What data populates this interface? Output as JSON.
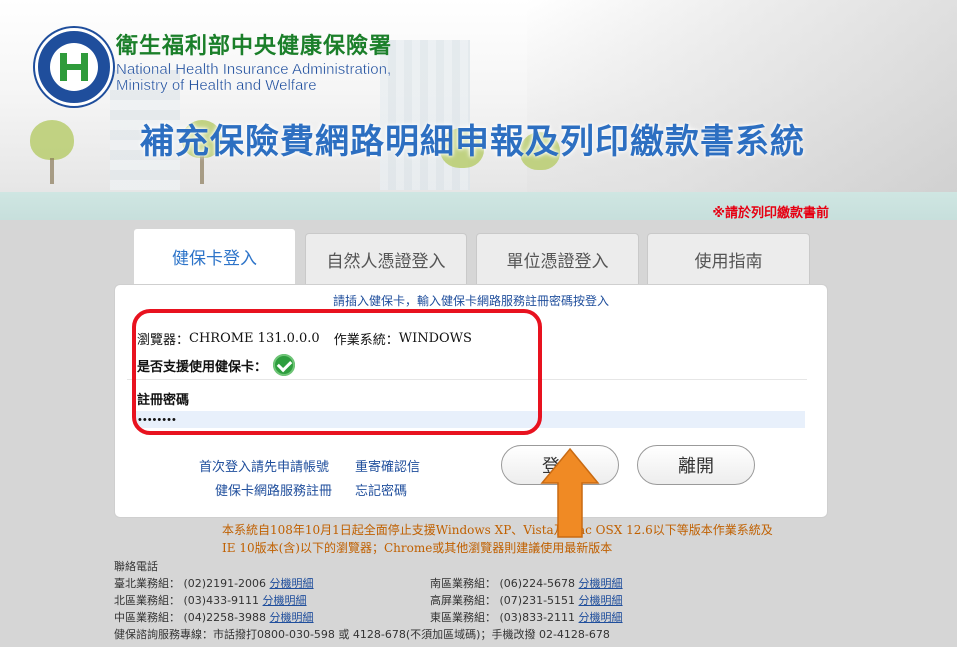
{
  "header": {
    "org_name_zh": "衛生福利部中央健康保險署",
    "org_name_en_line1": "National Health Insurance Administration,",
    "org_name_en_line2": "Ministry of Health and Welfare",
    "system_title": "補充保險費網路明細申報及列印繳款書系統",
    "top_notice": "※請於列印繳款書前"
  },
  "tabs": [
    {
      "label": "健保卡登入",
      "active": true
    },
    {
      "label": "自然人憑證登入",
      "active": false
    },
    {
      "label": "單位憑證登入",
      "active": false
    },
    {
      "label": "使用指南",
      "active": false
    }
  ],
  "panel": {
    "instruction": "請插入健保卡，輸入健保卡網路服務註冊密碼按登入",
    "browser_label": "瀏覽器：",
    "browser_value": "CHROME 131.0.0.0",
    "os_label": "作業系統：",
    "os_value": "WINDOWS",
    "support_label": "是否支援使用健保卡：",
    "support_icon": "check-circle-icon",
    "password_label": "註冊密碼",
    "password_value": "••••••••",
    "links": {
      "apply_account": "首次登入請先申請帳號",
      "resend_confirm": "重寄確認信",
      "register_service": "健保卡網路服務註冊",
      "forgot_password": "忘記密碼"
    },
    "login_button": "登入",
    "exit_button": "離開"
  },
  "warning_lines": [
    "本系統自108年10月1日起全面停止支援Windows XP、Vista及Mac OSX 12.6以下等版本作業系統及",
    "IE 10版本(含)以下的瀏覽器；Chrome或其他瀏覽器則建議使用最新版本"
  ],
  "contact": {
    "title": "聯絡電話",
    "rows": [
      {
        "left_label": "臺北業務組：",
        "left_phone": "(02)2191-2006",
        "left_link": "分機明細",
        "right_label": "南區業務組：",
        "right_phone": "(06)224-5678",
        "right_link": "分機明細"
      },
      {
        "left_label": "北區業務組：",
        "left_phone": "(03)433-9111",
        "left_link": "分機明細",
        "right_label": "高屏業務組：",
        "right_phone": "(07)231-5151",
        "right_link": "分機明細"
      },
      {
        "left_label": "中區業務組：",
        "left_phone": "(04)2258-3988",
        "left_link": "分機明細",
        "right_label": "東區業務組：",
        "right_phone": "(03)833-2111",
        "right_link": "分機明細"
      }
    ],
    "hotline": "健保諮詢服務專線：市話撥打0800-030-598 或 4128-678(不須加區域碼)；手機改撥 02-4128-678"
  },
  "colors": {
    "highlight_frame": "#e8121f",
    "arrow": "#f08a24",
    "title_blue": "#2d6fc1",
    "org_green": "#1b7f2a"
  }
}
